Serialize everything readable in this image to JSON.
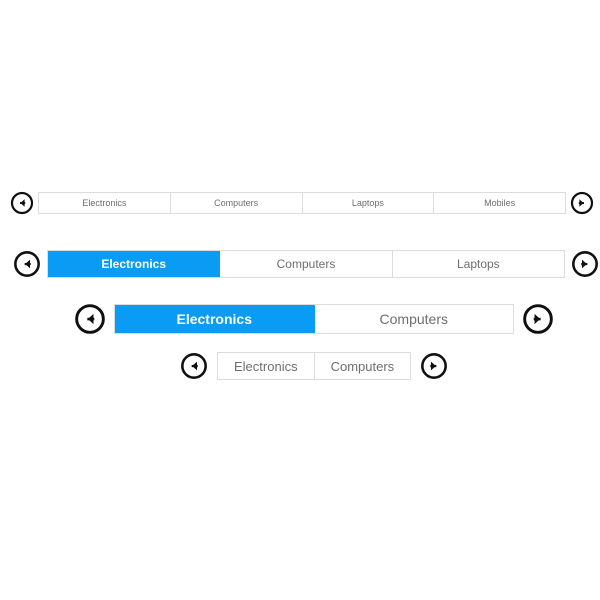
{
  "page": {
    "background_color": "#ffffff",
    "accent_color": "#0a9bf5",
    "border_color": "#dcdcdc",
    "tab_text_color": "#6e6e6e",
    "selected_text_color": "#ffffff",
    "arrow_color": "#101010"
  },
  "icons": {
    "prev_arrow": "circle-arrow-left-icon",
    "next_arrow": "circle-arrow-right-icon"
  },
  "carousels": [
    {
      "id": "row-xs",
      "size_label": "extra-small",
      "prev_label": "←",
      "next_label": "→",
      "selected_index": -1,
      "tabs": [
        {
          "label": "Electronics",
          "selected": false
        },
        {
          "label": "Computers",
          "selected": false
        },
        {
          "label": "Laptops",
          "selected": false
        },
        {
          "label": "Mobiles",
          "selected": false
        }
      ]
    },
    {
      "id": "row-sm",
      "size_label": "small",
      "prev_label": "←",
      "next_label": "→",
      "selected_index": 0,
      "tabs": [
        {
          "label": "Electronics",
          "selected": true
        },
        {
          "label": "Computers",
          "selected": false
        },
        {
          "label": "Laptops",
          "selected": false
        }
      ]
    },
    {
      "id": "row-md",
      "size_label": "medium",
      "prev_label": "←",
      "next_label": "→",
      "selected_index": 0,
      "tabs": [
        {
          "label": "Electronics",
          "selected": true
        },
        {
          "label": "Computers",
          "selected": false
        }
      ]
    },
    {
      "id": "row-auto",
      "size_label": "auto",
      "prev_label": "←",
      "next_label": "→",
      "selected_index": -1,
      "tabs": [
        {
          "label": "Electronics",
          "selected": false
        },
        {
          "label": "Computers",
          "selected": false
        }
      ]
    }
  ]
}
